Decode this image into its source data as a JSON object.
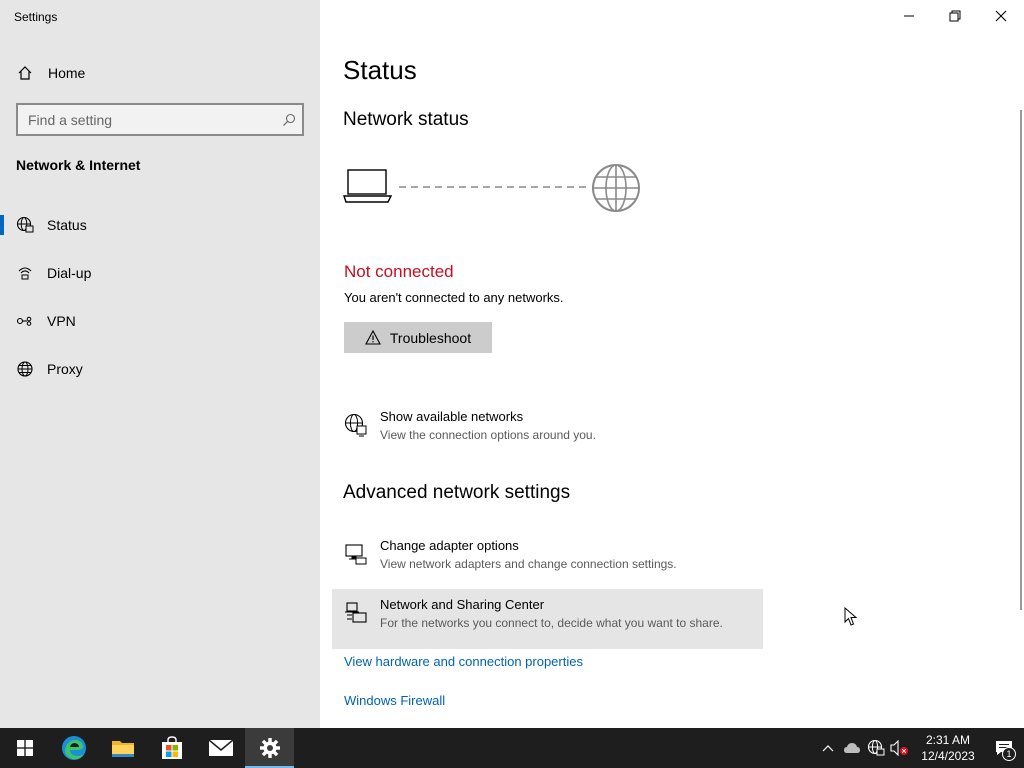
{
  "window": {
    "title": "Settings",
    "controls": [
      "minimize-icon",
      "restore-icon",
      "close-icon"
    ]
  },
  "sidebar": {
    "home_label": "Home",
    "search_placeholder": "Find a setting",
    "section_title": "Network & Internet",
    "items": [
      {
        "label": "Status",
        "icon": "globe-network-icon",
        "active": true
      },
      {
        "label": "Dial-up",
        "icon": "dialup-icon",
        "active": false
      },
      {
        "label": "VPN",
        "icon": "vpn-icon",
        "active": false
      },
      {
        "label": "Proxy",
        "icon": "globe-icon",
        "active": false
      }
    ]
  },
  "main": {
    "page_title": "Status",
    "network_status_heading": "Network status",
    "status": {
      "title": "Not connected",
      "description": "You aren't connected to any networks.",
      "title_color": "#c50f1f"
    },
    "troubleshoot_label": "Troubleshoot",
    "show_networks": {
      "title": "Show available networks",
      "description": "View the connection options around you."
    },
    "advanced_heading": "Advanced network settings",
    "adapter": {
      "title": "Change adapter options",
      "description": "View network adapters and change connection settings."
    },
    "sharing": {
      "title": "Network and Sharing Center",
      "description": "For the networks you connect to, decide what you want to share."
    },
    "links": {
      "hardware": "View hardware and connection properties",
      "firewall": "Windows Firewall"
    },
    "link_color": "#0063b1",
    "accent_color": "#0067c0"
  },
  "taskbar": {
    "apps": [
      "start-icon",
      "edge-icon",
      "file-explorer-icon",
      "store-icon",
      "mail-icon",
      "settings-icon"
    ],
    "active_app": "settings-icon",
    "time": "2:31 AM",
    "date": "12/4/2023",
    "notification_count": "1"
  }
}
